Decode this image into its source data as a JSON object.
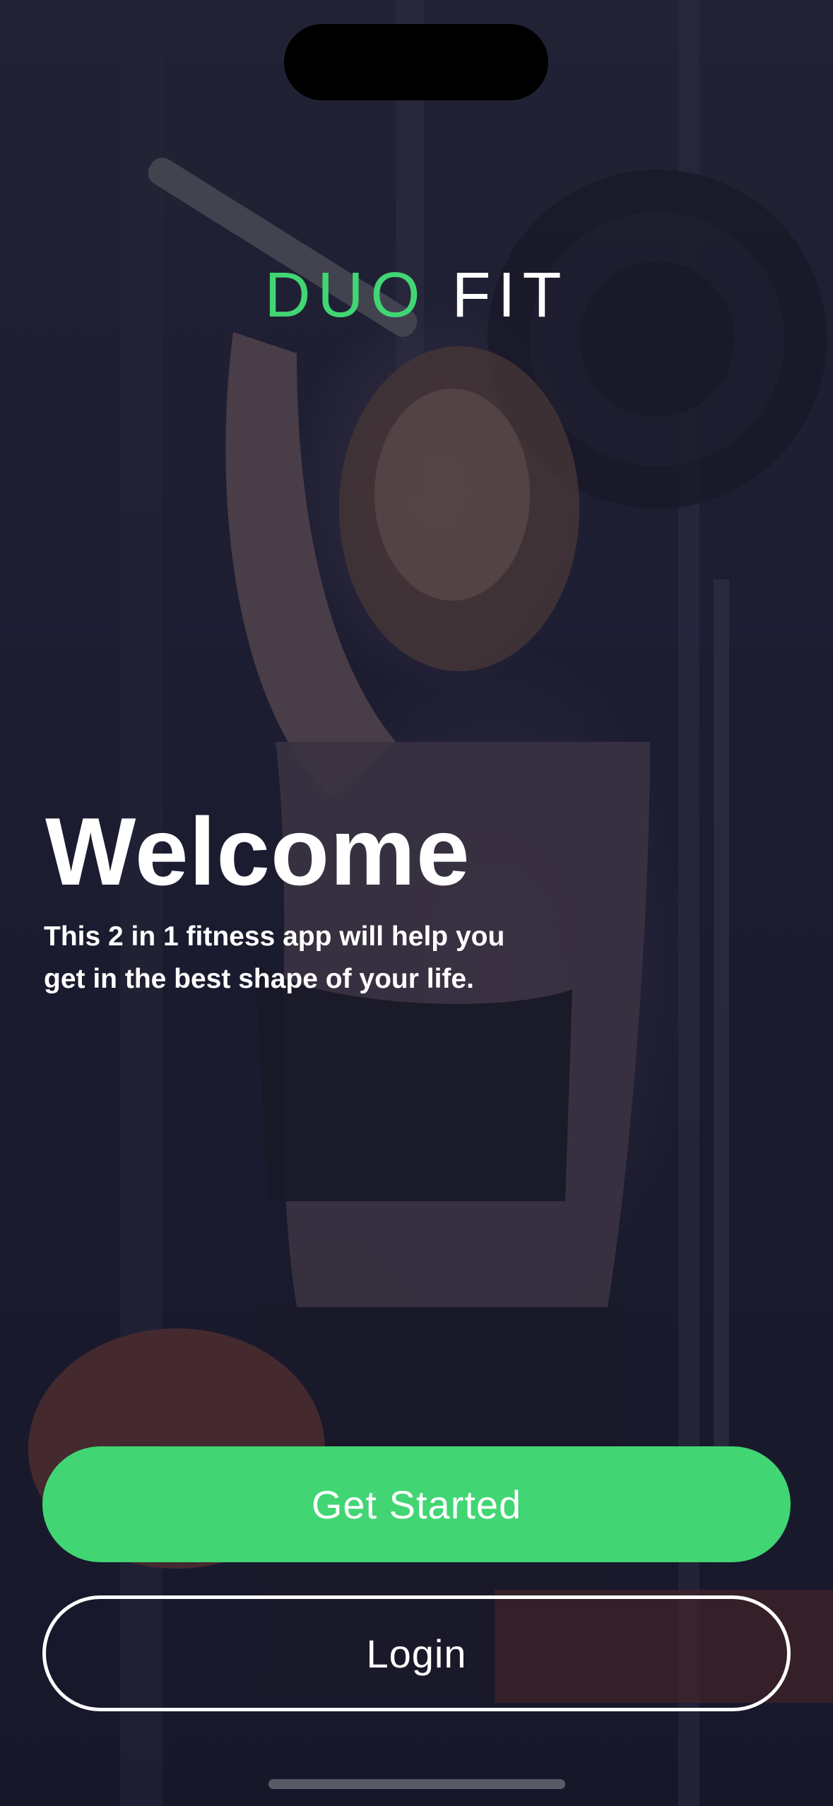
{
  "app": {
    "logo_part1": "DUO",
    "logo_part2": "FIT"
  },
  "hero": {
    "title": "Welcome",
    "subtitle_line1": "This 2 in 1 fitness app will help you",
    "subtitle_line2": "get in the best shape of your life."
  },
  "actions": {
    "get_started_label": "Get Started",
    "login_label": "Login"
  },
  "colors": {
    "accent": "#41d673",
    "text": "#ffffff",
    "background": "#1f1f33"
  }
}
